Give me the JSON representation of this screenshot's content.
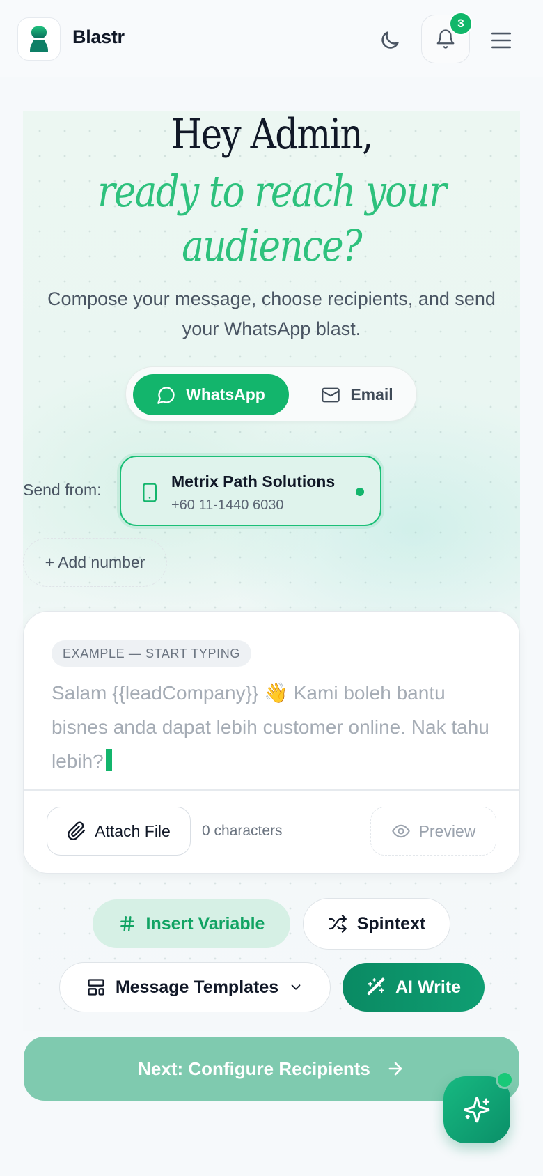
{
  "header": {
    "app_title": "Blastr",
    "notification_count": "3",
    "icons": [
      "logo-icon",
      "moon-icon",
      "bell-icon",
      "menu-icon"
    ]
  },
  "hero": {
    "greeting": "Hey Admin,",
    "tagline_line1": "ready to reach your",
    "tagline_line2": "audience?",
    "subtitle": "Compose your message, choose recipients, and send your WhatsApp blast."
  },
  "channels": {
    "whatsapp_label": "WhatsApp",
    "email_label": "Email",
    "selected": "WhatsApp"
  },
  "sender": {
    "label": "Send from:",
    "name": "Metrix Path Solutions",
    "phone": "+60 11-1440 6030",
    "add_number_label": "+ Add number"
  },
  "composer": {
    "example_chip": "EXAMPLE — START TYPING",
    "placeholder_text": "Salam {{leadCompany}} 👋 Kami boleh bantu bisnes anda dapat lebih customer online. Nak tahu lebih?",
    "attach_label": "Attach File",
    "char_count": "0 characters",
    "preview_label": "Preview"
  },
  "tools": {
    "insert_variable_label": "Insert Variable",
    "spintext_label": "Spintext",
    "templates_label": "Message Templates",
    "ai_write_label": "AI Write"
  },
  "next_label": "Next: Configure Recipients",
  "colors": {
    "accent": "#13b56c",
    "accent_dark": "#0a8a63",
    "tagline": "#2ec17d",
    "next_disabled": "#7fcaaf"
  }
}
